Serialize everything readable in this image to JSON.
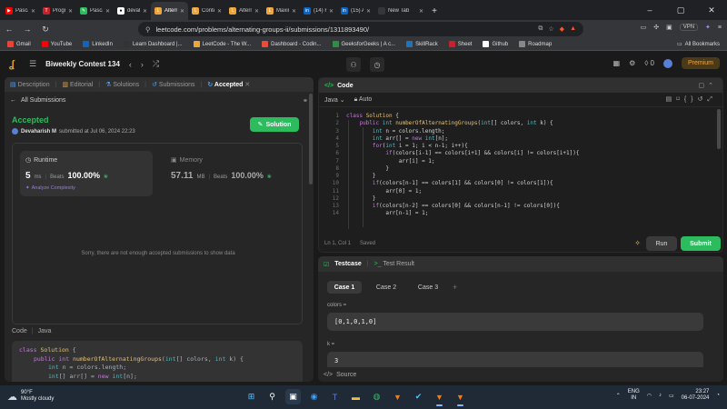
{
  "browser": {
    "tabs": [
      {
        "title": "Pascal Triang",
        "fav_color": "#ff0000",
        "fav_glyph": "▶"
      },
      {
        "title": "Program to c",
        "fav_color": "#c4232b",
        "fav_glyph": "T"
      },
      {
        "title": "Pascal's Trian",
        "fav_color": "#2cbb5d",
        "fav_glyph": "✎"
      },
      {
        "title": "devaharish2",
        "fav_color": "#ffffff",
        "fav_glyph": "●"
      },
      {
        "title": "Alternat",
        "fav_color": "#f0a53a",
        "fav_glyph": "L"
      },
      {
        "title": "Contest - Le",
        "fav_color": "#f0a53a",
        "fav_glyph": "L"
      },
      {
        "title": "Alternating G",
        "fav_color": "#f0a53a",
        "fav_glyph": "L"
      },
      {
        "title": "Maximum P",
        "fav_color": "#f0a53a",
        "fav_glyph": "L"
      },
      {
        "title": "(14) Feed | Li",
        "fav_color": "#0a66c2",
        "fav_glyph": "in"
      },
      {
        "title": "(15) Activity",
        "fav_color": "#0a66c2",
        "fav_glyph": "in"
      },
      {
        "title": "New Tab",
        "fav_color": "#35363a",
        "fav_glyph": ""
      }
    ],
    "url": "leetcode.com/problems/alternating-groups-ii/submissions/1311893490/",
    "vpn_label": "VPN"
  },
  "bookmarks": {
    "items": [
      {
        "label": "Gmail",
        "color": "#ea4335"
      },
      {
        "label": "YouTube",
        "color": "#ff0000"
      },
      {
        "label": "LinkedIn",
        "color": "#0a66c2"
      },
      {
        "label": "Learn Dashboard |...",
        "color": "#333333"
      },
      {
        "label": "LeetCode - The W...",
        "color": "#f0a53a"
      },
      {
        "label": "Dashboard - Codin...",
        "color": "#e84c3d"
      },
      {
        "label": "GeeksforGeeks | A c...",
        "color": "#2f8d46"
      },
      {
        "label": "SkillRack",
        "color": "#1b75bc"
      },
      {
        "label": "Sheet",
        "color": "#c4232b"
      },
      {
        "label": "Github",
        "color": "#ffffff"
      },
      {
        "label": "Roadmap",
        "color": "#888888"
      }
    ],
    "all_label": "All Bookmarks"
  },
  "leetcode_nav": {
    "contest_title": "Biweekly Contest 134",
    "streak_count": "0",
    "premium_label": "Premium"
  },
  "left_panel": {
    "tabs": {
      "description": "Description",
      "editorial": "Editorial",
      "solutions": "Solutions",
      "submissions": "Submissions",
      "accepted": "Accepted"
    },
    "all_submissions": "All Submissions",
    "status": "Accepted",
    "submitter_name": "Devaharish M",
    "submitted_text": "submitted at Jul 06, 2024 22:23",
    "solution_button": "Solution",
    "runtime": {
      "label": "Runtime",
      "value": "5",
      "unit": "ms",
      "beats_label": "Beats",
      "beats_pct": "100.00%",
      "analyze_label": "Analyze Complexity"
    },
    "memory": {
      "label": "Memory",
      "value": "57.11",
      "unit": "MB",
      "beats_label": "Beats",
      "beats_pct": "100.00%"
    },
    "empty_message": "Sorry, there are not enough accepted submissions to show data",
    "code_label": "Code",
    "code_lang": "Java"
  },
  "code_panel": {
    "title": "Code",
    "language": "Java",
    "autosave": "Auto",
    "cursor_pos": "Ln 1, Col 1",
    "save_status": "Saved",
    "run_label": "Run",
    "submit_label": "Submit"
  },
  "test_panel": {
    "testcase_tab": "Testcase",
    "result_tab": "Test Result",
    "cases": [
      "Case 1",
      "Case 2",
      "Case 3"
    ],
    "param1_label": "colors =",
    "param1_value": "[0,1,0,1,0]",
    "param2_label": "k =",
    "param2_value": "3",
    "source_label": "Source"
  },
  "taskbar": {
    "temperature": "90°F",
    "weather": "Mostly cloudy",
    "lang1": "ENG",
    "lang2": "IN",
    "time": "23:27",
    "date": "06-07-2024"
  }
}
